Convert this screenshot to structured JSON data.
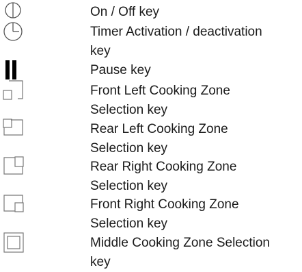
{
  "legend": {
    "items": [
      {
        "icon": "power-icon",
        "label": "On / Off key"
      },
      {
        "icon": "timer-icon",
        "label": "Timer Activation / deactivation\nkey"
      },
      {
        "icon": "pause-icon",
        "label": "Pause key"
      },
      {
        "icon": "front-left-zone-icon",
        "label": "Front Left Cooking Zone\nSelection key"
      },
      {
        "icon": "rear-left-zone-icon",
        "label": "Rear Left Cooking Zone\nSelection key"
      },
      {
        "icon": "rear-right-zone-icon",
        "label": "Rear Right Cooking Zone\nSelection key"
      },
      {
        "icon": "front-right-zone-icon",
        "label": "Front Right Cooking Zone\nSelection key"
      },
      {
        "icon": "middle-zone-icon",
        "label": "Middle Cooking Zone Selection\nkey"
      }
    ]
  }
}
